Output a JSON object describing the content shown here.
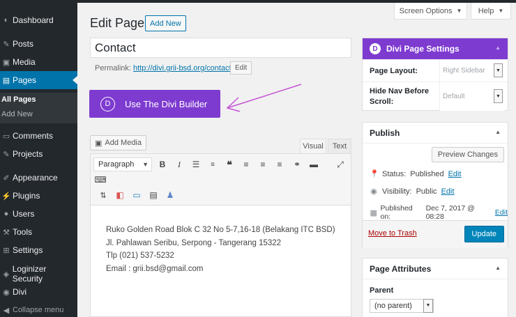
{
  "sidebar": {
    "items": [
      {
        "label": "Dashboard",
        "icon": "dashboard-icon"
      },
      {
        "label": "Posts",
        "icon": "pin-icon"
      },
      {
        "label": "Media",
        "icon": "media-icon"
      },
      {
        "label": "Pages",
        "icon": "pages-icon"
      },
      {
        "label": "Comments",
        "icon": "comment-icon"
      },
      {
        "label": "Projects",
        "icon": "pin-icon"
      },
      {
        "label": "Appearance",
        "icon": "brush-icon"
      },
      {
        "label": "Plugins",
        "icon": "plug-icon"
      },
      {
        "label": "Users",
        "icon": "users-icon"
      },
      {
        "label": "Tools",
        "icon": "wrench-icon"
      },
      {
        "label": "Settings",
        "icon": "settings-icon"
      },
      {
        "label": "Loginizer Security",
        "icon": "shield-icon"
      },
      {
        "label": "Divi",
        "icon": "divi-icon"
      },
      {
        "label": "Collapse menu",
        "icon": "collapse-icon"
      }
    ],
    "submenu": [
      "All Pages",
      "Add New"
    ]
  },
  "top": {
    "screen_options": "Screen Options",
    "help": "Help"
  },
  "page": {
    "heading": "Edit Page",
    "add_new": "Add New",
    "title_value": "Contact",
    "permalink_label": "Permalink:",
    "permalink_url": "http://divi.grii-bsd.org/contact/",
    "permalink_edit": "Edit",
    "divi_button": "Use The Divi Builder"
  },
  "editor": {
    "add_media": "Add Media",
    "tab_visual": "Visual",
    "tab_text": "Text",
    "format": "Paragraph",
    "lines": [
      "Ruko Golden Road Blok C 32 No 5-7,16-18 (Belakang ITC BSD)",
      "Jl. Pahlawan Seribu, Serpong - Tangerang 15322",
      "Tlp (021) 537-5232",
      "Email : grii.bsd@gmail.com"
    ]
  },
  "divi_settings": {
    "title": "Divi Page Settings",
    "layout_label": "Page Layout:",
    "layout_value": "Right Sidebar",
    "hide_nav_label_1": "Hide Nav Before",
    "hide_nav_label_2": "Scroll:",
    "hide_nav_value": "Default"
  },
  "publish": {
    "title": "Publish",
    "preview": "Preview Changes",
    "status_label": "Status:",
    "status_value": "Published",
    "visibility_label": "Visibility:",
    "visibility_value": "Public",
    "published_on_label": "Published on:",
    "published_on_value": "Dec 7, 2017 @ 08:28",
    "edit": "Edit",
    "trash": "Move to Trash",
    "update": "Update"
  },
  "attributes": {
    "title": "Page Attributes",
    "parent_label": "Parent",
    "parent_value": "(no parent)"
  },
  "colors": {
    "accent": "#0073aa",
    "divi": "#7e3bd0",
    "sidebar": "#23282d",
    "arrow": "#c653d6"
  }
}
